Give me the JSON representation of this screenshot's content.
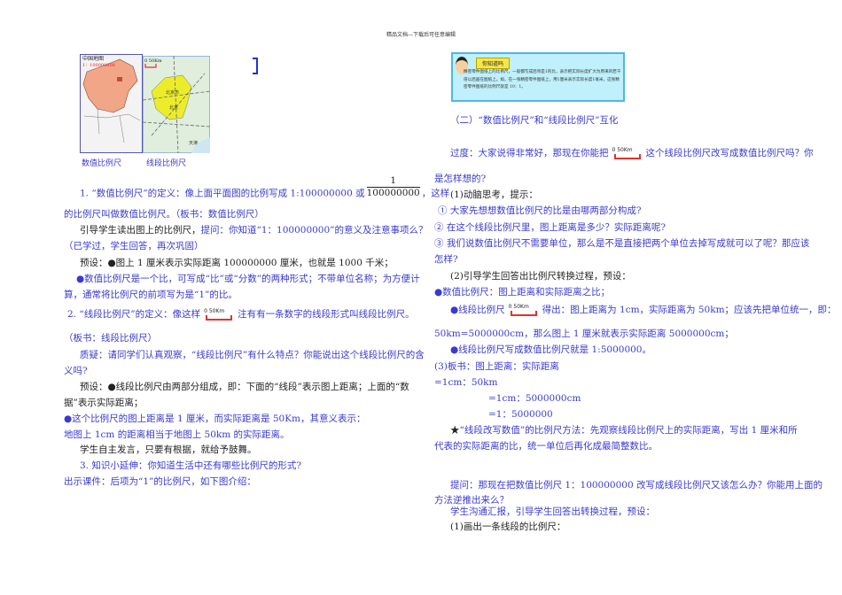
{
  "header": "精品文档---下载后可任意编辑",
  "maps": {
    "china_title": "中国地图",
    "china_scale": "1：100000000",
    "scale_bar_label": "0   50Km",
    "beijing_city": "北京市",
    "beijing": "北京",
    "tianjin": "天津",
    "caption_left": "数值比例尺",
    "caption_right": "线段比例尺"
  },
  "scale_icon": "0   50Km",
  "left": {
    "l1a": "1. “数值比例尺”的定义：像上面平面图的比例写成 1:100000000 或",
    "frac_num": "1",
    "frac_den": "100000000",
    "l1b": "，这样",
    "l2": "的比例尺叫做数值比例尺。（板书：数值比例尺）",
    "l3a": "引导学生读出图上的比例尺，",
    "l3b": "提问：你知道“1：100000000”的意义及注意事项么？",
    "l4": "（已学过，学生回答，再次巩固）",
    "l5a": "预设：",
    "l5b": "●图上 1 厘米表示实际距离 100000000 厘米，也就是 1000 千米；",
    "l6": "●数值比例尺是一个比，可写成“比”或“分数”的两种形式；不带单位名称；为方便计",
    "l7": "算，通常将比例尺的前项写为是“1”的比。",
    "l8a": "2. “线段比例尺”的定义：像这样",
    "l8b": "注有有一条数字的线段形式叫线段比例尺。",
    "l9": "（板书：线段比例尺）",
    "l10": "质疑：请同学们认真观察，“线段比例尺”有什么特点？你能说出这个线段比例尺的含",
    "l11": "义吗?",
    "l12a": "预设：",
    "l12b": "●线段比例尺由两部分组成，即：下面的“线段”表示图上距离；上面的“数",
    "l13": "据”表示实际距离；",
    "l14": "●这个比例尺的图上距离是 1 厘米，而实际距离是 50Km，其意义表示：",
    "l15": "地图上 1cm 的距离相当于地图上 50km 的实际距离。",
    "l16": "学生自主发言，只要有根据，就给予鼓舞。",
    "l17": "3. 知识小延伸：你知道生活中还有哪些比例尺的形式?",
    "l18": "出示课件：后项为“1”的比例尺，如下图介绍："
  },
  "card": {
    "tag": "你知道吗",
    "text": "精密零件图纸上的比例尺，一般都写成后项是1的比，表示把实际长度扩大为原来的若干倍以后画在图纸上。如，在一张精密零件图纸上，用1厘米表示实际长度1毫米，这张精密零件图纸的比例尺就是 10：1。"
  },
  "right": {
    "r1": "（二）“数值比例尺”和“线段比例尺”互化",
    "r2a": "过度：大家说得非常好，那现在你能把",
    "r2b": "这个线段比例尺改写成数值比例尺吗？你",
    "r3": "是怎样想的?",
    "r4": "(1)动脑思考，提示：",
    "r5": "① 大家先想想数值比例尺的比是由哪两部分构成?",
    "r6": "② 在这个线段比例尺里，图上距离是多少？实际距离呢?",
    "r7": "③ 我们说数值比例尺不需要单位，那么是不是直接把两个单位去掉写成就可以了呢？那应该",
    "r8": "怎样?",
    "r9": "(2)引导学生回答出比例尺转换过程，预设：",
    "r10": "●数值比例尺：图上距离和实际距离之比；",
    "r11a": "●线段比例尺",
    "r11b": "得出：图上距离为 1cm，实际距离为 50km；应该先把单位统一，即：",
    "r12": "50km=5000000cm，那么图上 1 厘米就表示实际距离 5000000cm；",
    "r13": "●线段比例尺写成数值比例尺就是 1:5000000。",
    "r14": "(3)板书：图上距离：实际距离",
    "r15": "=1cm：50km",
    "r16": "=1cm：5000000cm",
    "r17": "=1：5000000",
    "r18a": "★",
    "r18b": "“线段改写数值”的比例尺方法：先观察线段比例尺上的实际距离，写出 1 厘米和所",
    "r19": "代表的实际距离的比，统一单位后再化成最简整数比。",
    "r20": "提问：那现在把数值比例尺 1：100000000 改写成线段比例尺又该怎么办？你能用上面的",
    "r21": "方法逆推出来么？",
    "r22": "学生沟通汇报，引导学生回答出转换过程，预设：",
    "r23": "(1)画出一条线段的比例尺："
  }
}
